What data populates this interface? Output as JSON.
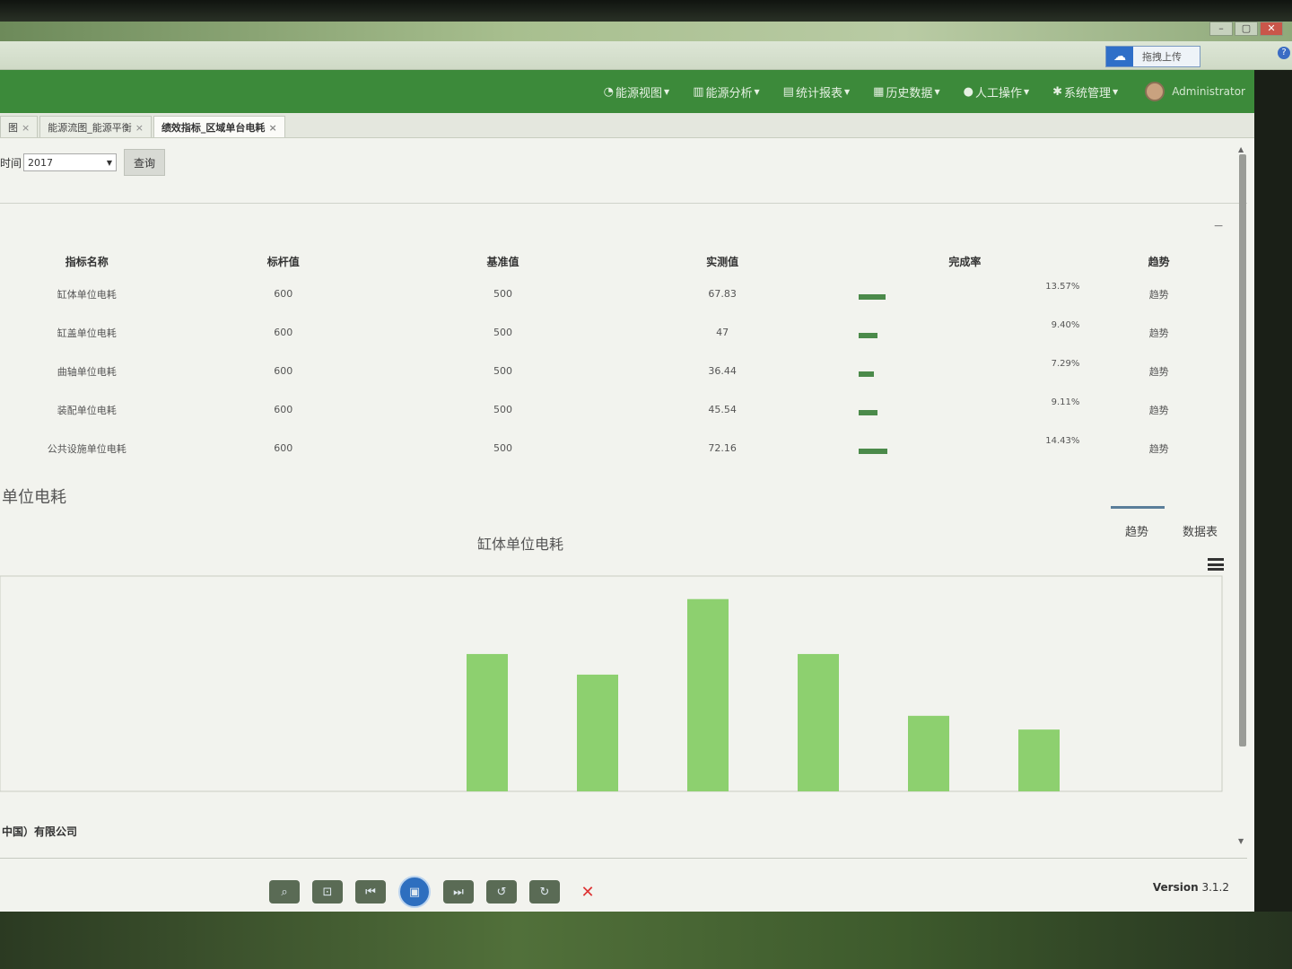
{
  "nav": {
    "upload_label": "拖拽上传",
    "help": "?",
    "items": [
      {
        "icon": "dashboard-icon",
        "glyph": "◔",
        "label": "能源视图"
      },
      {
        "icon": "bar-chart-icon",
        "glyph": "▥",
        "label": "能源分析"
      },
      {
        "icon": "report-icon",
        "glyph": "▤",
        "label": "统计报表"
      },
      {
        "icon": "book-icon",
        "glyph": "▦",
        "label": "历史数据"
      },
      {
        "icon": "user-icon",
        "glyph": "●",
        "label": "人工操作"
      },
      {
        "icon": "gear-icon",
        "glyph": "✱",
        "label": "系统管理"
      }
    ],
    "user": "Administrator"
  },
  "tabs": [
    {
      "label": "图",
      "active": false
    },
    {
      "label": "能源流图_能源平衡",
      "active": false
    },
    {
      "label": "绩效指标_区域单台电耗",
      "active": true
    }
  ],
  "filter": {
    "label": "时间",
    "value": "2017",
    "query_label": "查询"
  },
  "table": {
    "headers": [
      "指标名称",
      "标杆值",
      "基准值",
      "实测值",
      "完成率",
      "趋势"
    ],
    "rows": [
      {
        "name": "缸体单位电耗",
        "benchmark": "600",
        "baseline": "500",
        "actual": "67.83",
        "rate": "13.57%",
        "rate_value": 13.57,
        "trend": "趋势"
      },
      {
        "name": "缸盖单位电耗",
        "benchmark": "600",
        "baseline": "500",
        "actual": "47",
        "rate": "9.40%",
        "rate_value": 9.4,
        "trend": "趋势"
      },
      {
        "name": "曲轴单位电耗",
        "benchmark": "600",
        "baseline": "500",
        "actual": "36.44",
        "rate": "7.29%",
        "rate_value": 7.29,
        "trend": "趋势"
      },
      {
        "name": "装配单位电耗",
        "benchmark": "600",
        "baseline": "500",
        "actual": "45.54",
        "rate": "9.11%",
        "rate_value": 9.11,
        "trend": "趋势"
      },
      {
        "name": "公共设施单位电耗",
        "benchmark": "600",
        "baseline": "500",
        "actual": "72.16",
        "rate": "14.43%",
        "rate_value": 14.43,
        "trend": "趋势"
      }
    ]
  },
  "section": {
    "title": "单位电耗",
    "tab_trend": "趋势",
    "tab_table": "数据表"
  },
  "chart_data": {
    "type": "bar",
    "title": "缸体单位电耗",
    "categories": [
      "",
      "",
      "",
      "",
      "",
      ""
    ],
    "values": [
      10.0,
      8.5,
      14.0,
      10.0,
      5.5,
      4.5
    ],
    "color": "#8dd06f",
    "grid": true
  },
  "footer": {
    "company": "中国）有限公司",
    "version_label": "Version",
    "version_num": "3.1.2"
  }
}
